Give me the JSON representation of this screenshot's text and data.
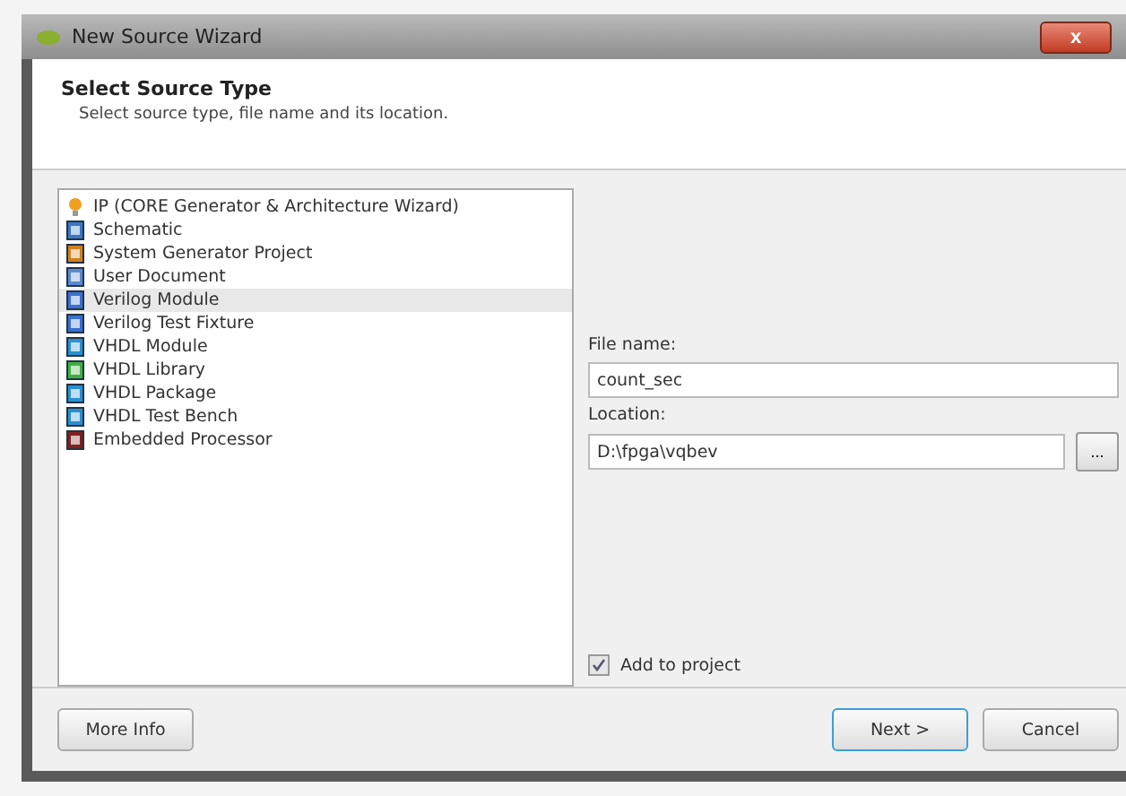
{
  "window": {
    "title": "New Source Wizard",
    "close": "x"
  },
  "header": {
    "title": "Select Source Type",
    "subtitle": "Select source type, file name and its location."
  },
  "source_types": [
    {
      "label": "IP (CORE Generator & Architecture Wizard)",
      "kind": "ip",
      "selected": false
    },
    {
      "label": "Schematic",
      "kind": "schematic",
      "selected": false
    },
    {
      "label": "System Generator Project",
      "kind": "sysgen",
      "selected": false
    },
    {
      "label": "User Document",
      "kind": "document",
      "selected": false
    },
    {
      "label": "Verilog Module",
      "kind": "verilog",
      "selected": true
    },
    {
      "label": "Verilog Test Fixture",
      "kind": "verilog",
      "selected": false
    },
    {
      "label": "VHDL Module",
      "kind": "vhdl",
      "selected": false
    },
    {
      "label": "VHDL Library",
      "kind": "library",
      "selected": false
    },
    {
      "label": "VHDL Package",
      "kind": "vhdl",
      "selected": false
    },
    {
      "label": "VHDL Test Bench",
      "kind": "vhdl",
      "selected": false
    },
    {
      "label": "Embedded Processor",
      "kind": "processor",
      "selected": false
    }
  ],
  "file_name": {
    "label": "File name:",
    "value": "count_sec"
  },
  "location": {
    "label": "Location:",
    "value": "D:\\fpga\\vqbev",
    "browse": "..."
  },
  "add_to_project": {
    "label": "Add to project",
    "checked": true
  },
  "buttons": {
    "more_info": "More Info",
    "next": "Next >",
    "cancel": "Cancel"
  }
}
